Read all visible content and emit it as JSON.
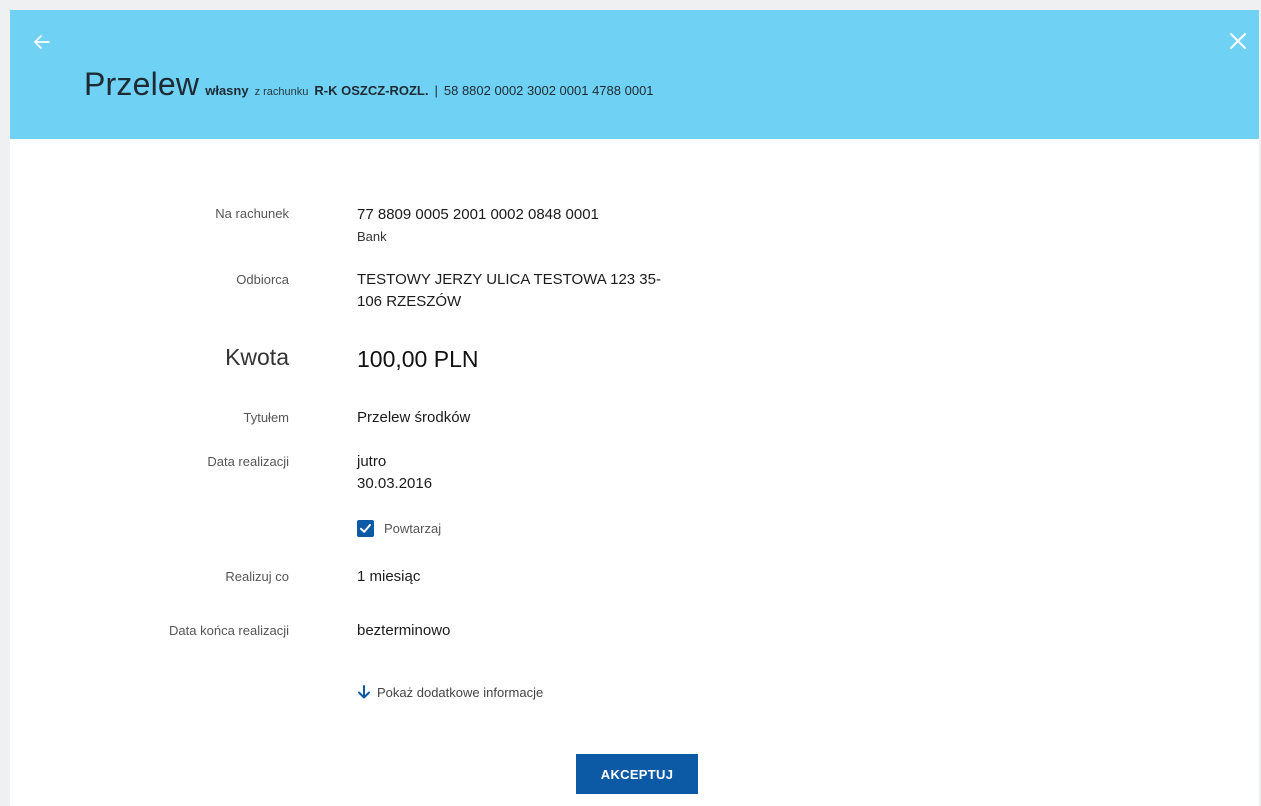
{
  "header": {
    "title": "Przelew",
    "type": "własny",
    "from_label": "z rachunku",
    "account_name": "R-K OSZCZ-ROZL.",
    "separator": "|",
    "account_number": "58 8802 0002 3002 0001 4788 0001",
    "bg_color": "#6fd1f3"
  },
  "fields": {
    "na_rachunek": {
      "label": "Na rachunek",
      "value": "77 8809 0005 2001 0002 0848 0001",
      "sub": "Bank"
    },
    "odbiorca": {
      "label": "Odbiorca",
      "line1": "TESTOWY JERZY ULICA TESTOWA 123 35-",
      "line2": "106 RZESZÓW"
    },
    "kwota": {
      "label": "Kwota",
      "value": "100,00 PLN"
    },
    "tytulem": {
      "label": "Tytułem",
      "value": "Przelew środków"
    },
    "data_realizacji": {
      "label": "Data realizacji",
      "line1": "jutro",
      "line2": "30.03.2016"
    },
    "powtarzaj": {
      "label": "Powtarzaj",
      "checked": true
    },
    "realizuj_co": {
      "label": "Realizuj co",
      "value": "1 miesiąc"
    },
    "data_konca": {
      "label": "Data końca realizacji",
      "value": "bezterminowo"
    }
  },
  "more_info": "Pokaż dodatkowe informacje",
  "accept_button": "AKCEPTUJ",
  "colors": {
    "accent": "#0c5aa6",
    "header": "#6fd1f3"
  }
}
